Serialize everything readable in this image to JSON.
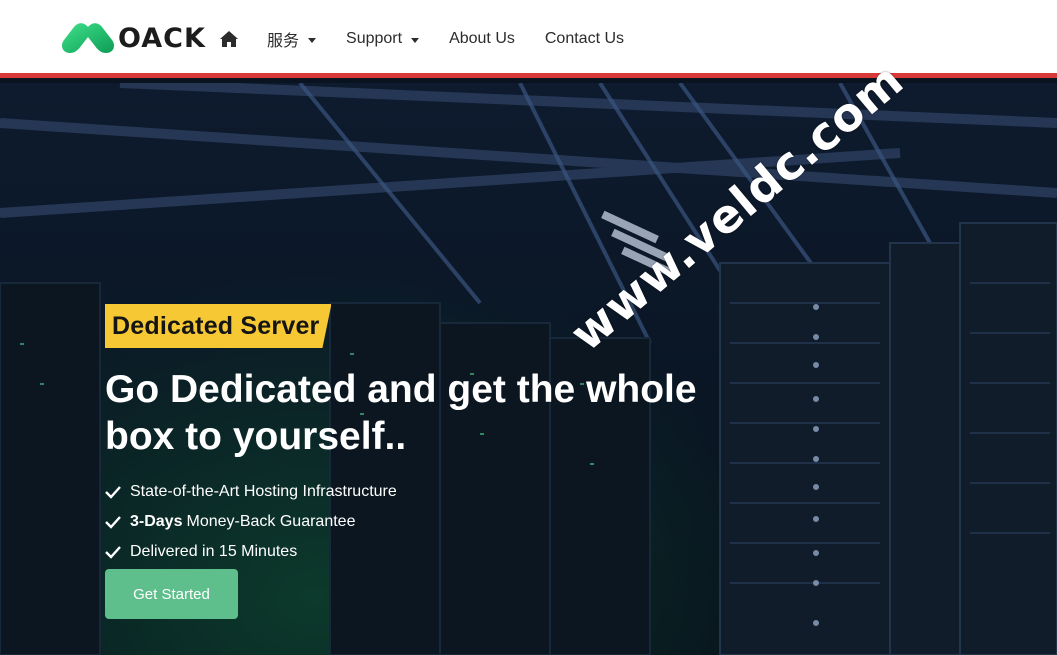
{
  "header": {
    "logo_text": "OACK",
    "nav": [
      {
        "label": "服务",
        "has_dropdown": true
      },
      {
        "label": "Support",
        "has_dropdown": true
      },
      {
        "label": "About Us",
        "has_dropdown": false
      },
      {
        "label": "Contact Us",
        "has_dropdown": false
      }
    ],
    "home_icon": "home-icon"
  },
  "hero": {
    "badge": "Dedicated Server",
    "headline_line1": "Go Dedicated and get the whole",
    "headline_line2": "box to yourself..",
    "features": [
      {
        "bold": "",
        "text": "State-of-the-Art Hosting Infrastructure"
      },
      {
        "bold": "3-Days",
        "text": "Money-Back Guarantee"
      },
      {
        "bold": "",
        "text": "Delivered in 15 Minutes"
      }
    ],
    "cta_label": "Get Started"
  },
  "watermark": "www.veldc.com",
  "colors": {
    "accent_red": "#d83a3a",
    "badge_yellow": "#f6c834",
    "cta_green": "#5fbf8c",
    "logo_green": "#27c070"
  }
}
